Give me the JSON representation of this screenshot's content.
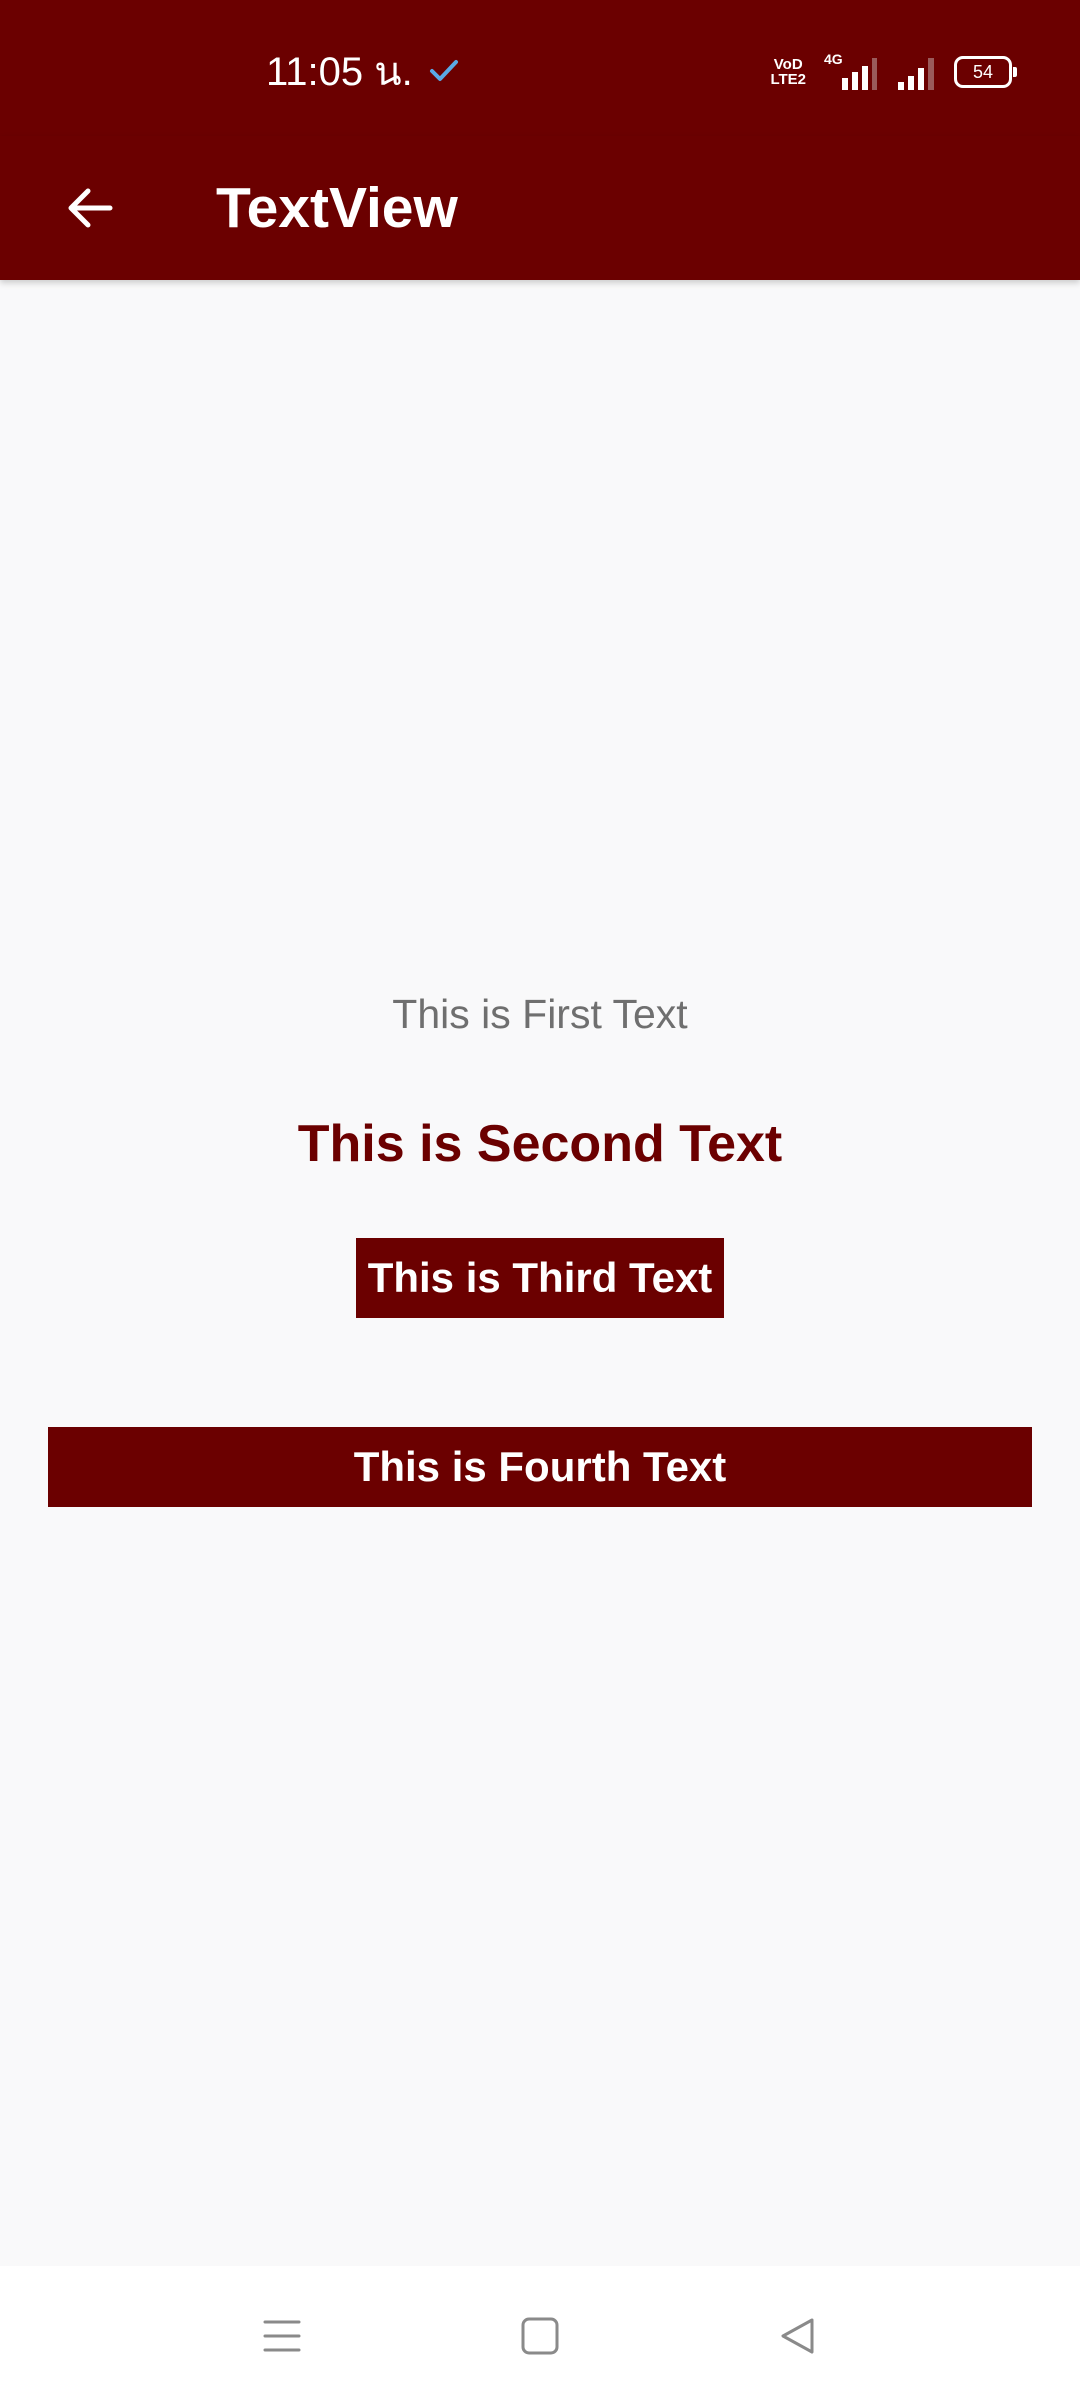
{
  "status_bar": {
    "time": "11:05 น.",
    "volte_line1": "VoD",
    "volte_line2": "LTE2",
    "network_type": "4G",
    "battery_level": "54",
    "icons": [
      "check-icon",
      "volte-icon",
      "signal-4g-icon",
      "signal-icon",
      "battery-icon"
    ]
  },
  "app_bar": {
    "title": "TextView",
    "back_icon": "arrow-left-icon"
  },
  "content": {
    "first_text": "This is First Text",
    "second_text": "This is Second Text",
    "third_text": "This is Third Text",
    "fourth_text": "This is Fourth Text"
  },
  "nav_bar": {
    "icons": [
      "menu-icon",
      "home-square-icon",
      "back-triangle-icon"
    ]
  },
  "colors": {
    "primary": "#6b0000",
    "background": "#f9f9fa",
    "secondary_text": "#6f6f6f",
    "on_primary": "#ffffff"
  }
}
